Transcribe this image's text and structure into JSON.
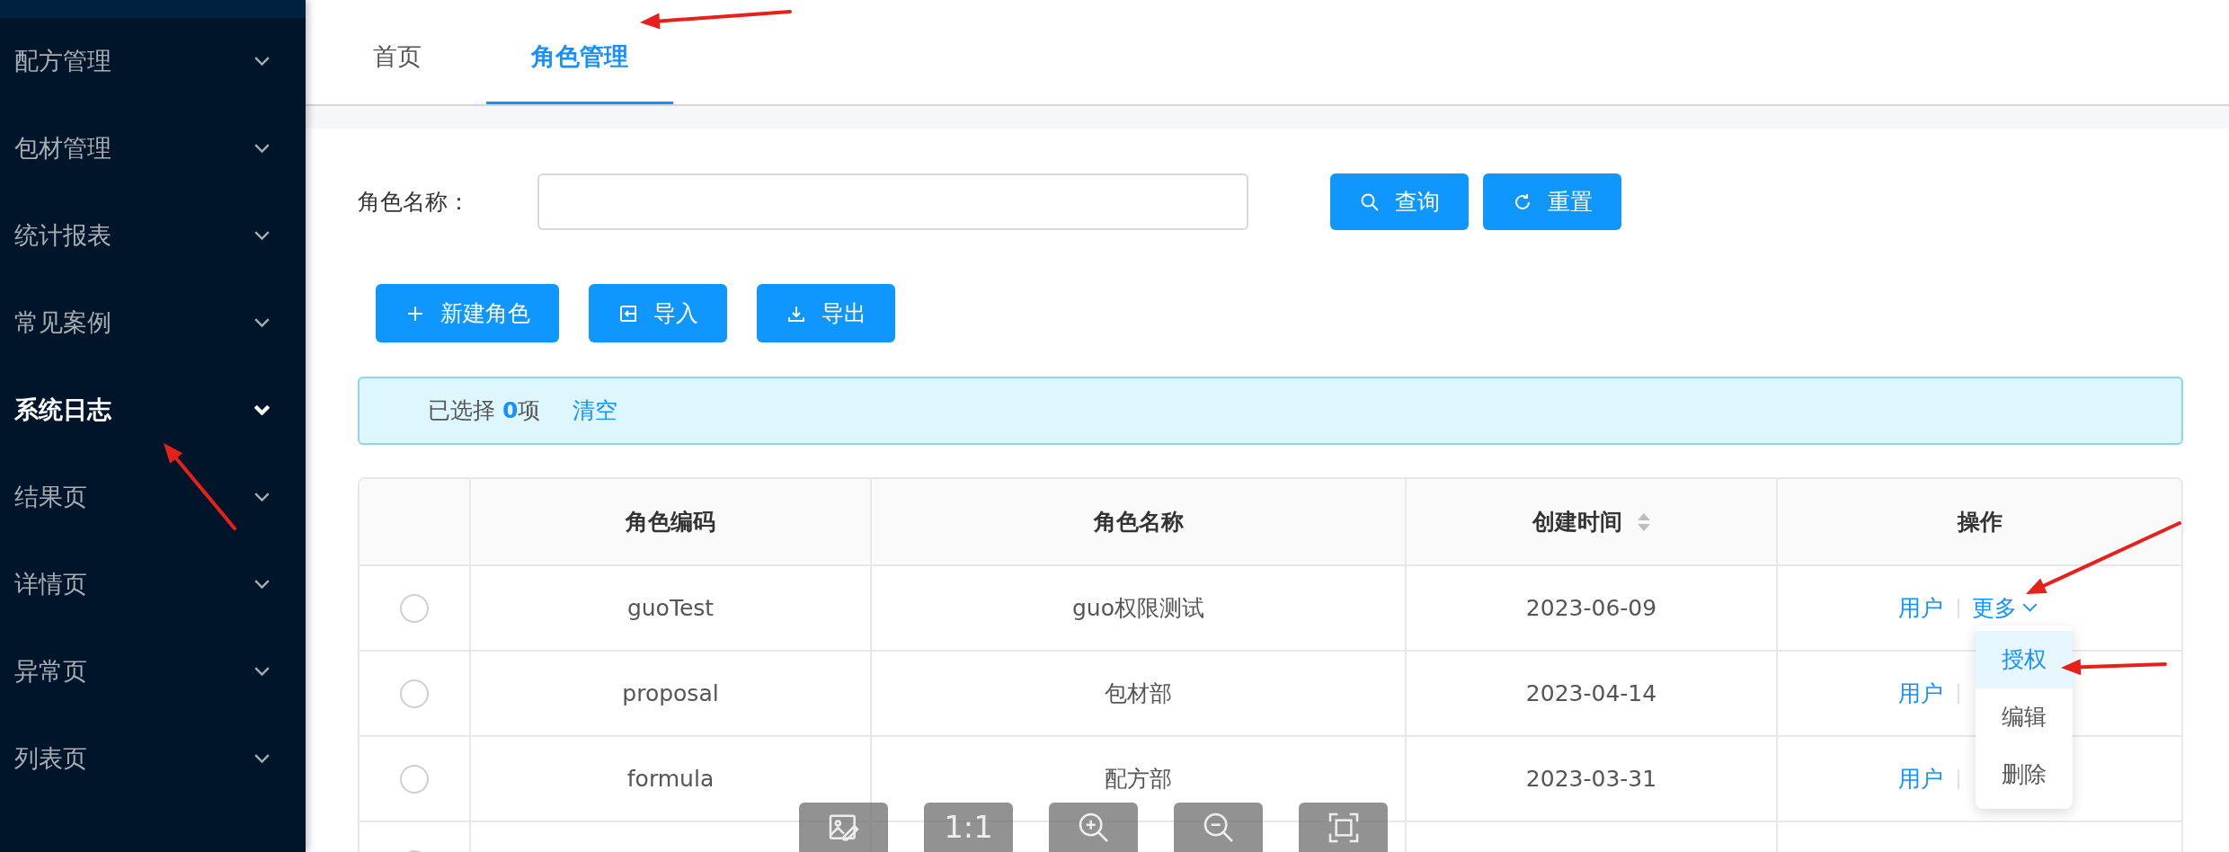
{
  "sidebar": {
    "items": [
      {
        "label": "配方管理",
        "selected": false
      },
      {
        "label": "包材管理",
        "selected": false
      },
      {
        "label": "统计报表",
        "selected": false
      },
      {
        "label": "常见案例",
        "selected": false
      },
      {
        "label": "系统日志",
        "selected": true
      },
      {
        "label": "结果页",
        "selected": false
      },
      {
        "label": "详情页",
        "selected": false
      },
      {
        "label": "异常页",
        "selected": false
      },
      {
        "label": "列表页",
        "selected": false
      }
    ]
  },
  "tabs": [
    {
      "label": "首页",
      "selected": false
    },
    {
      "label": "角色管理",
      "selected": true
    }
  ],
  "search": {
    "label": "角色名称：",
    "buttons": [
      {
        "kind": "search",
        "label": "查询"
      },
      {
        "kind": "reset",
        "label": "重置"
      }
    ]
  },
  "actions": [
    {
      "kind": "add",
      "label": "新建角色"
    },
    {
      "kind": "import",
      "label": "导入"
    },
    {
      "kind": "export",
      "label": "导出"
    }
  ],
  "selection_alert": {
    "text": "已选择 **0**项",
    "clear": "清空"
  },
  "table": {
    "columns": [
      {
        "label": "角色编码",
        "sortable": false
      },
      {
        "label": "角色名称",
        "sortable": false
      },
      {
        "label": "创建时间",
        "sortable": true
      },
      {
        "label": "操作",
        "sortable": false
      }
    ],
    "rows": [
      {
        "code": "guoTest",
        "name": "guo权限测试",
        "created": "2023-06-09",
        "selected": false,
        "user_link": "用户",
        "more_link": "更多"
      },
      {
        "code": "proposal",
        "name": "包材部",
        "created": "2023-04-14",
        "selected": false,
        "user_link": "用户"
      },
      {
        "code": "formula",
        "name": "配方部",
        "created": "2023-03-31",
        "selected": false,
        "user_link": "用户"
      },
      {
        "selected": false
      }
    ]
  },
  "dropdown": {
    "items": [
      {
        "label": "授权",
        "selected": true
      },
      {
        "label": "编辑",
        "selected": false
      },
      {
        "label": "删除",
        "selected": false
      }
    ]
  },
  "viewer_toolbar": {
    "buttons": [
      {
        "kind": "edit-image"
      },
      {
        "kind": "text",
        "label": "1:1"
      },
      {
        "kind": "zoom-in"
      },
      {
        "kind": "zoom-out"
      },
      {
        "kind": "fit"
      }
    ]
  }
}
